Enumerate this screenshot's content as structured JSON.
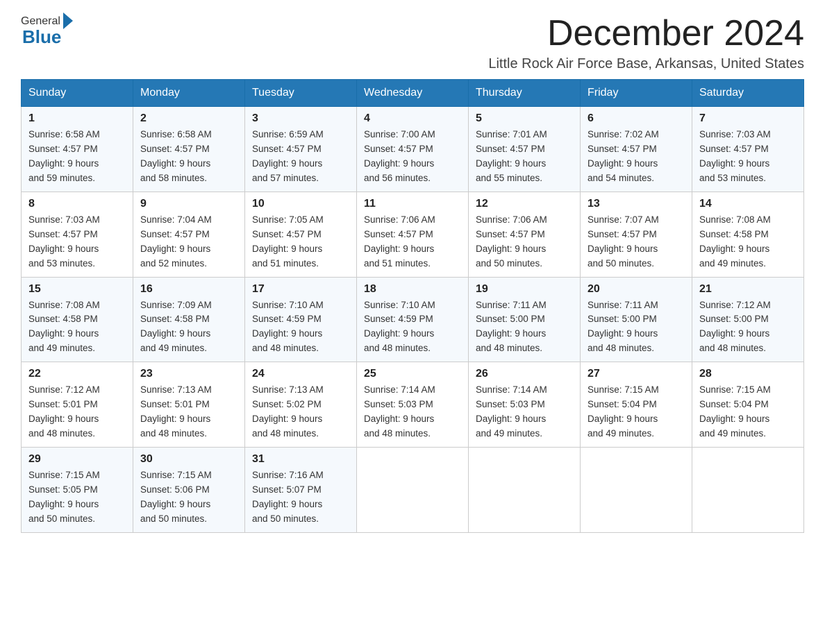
{
  "logo": {
    "general": "General",
    "blue": "Blue"
  },
  "header": {
    "month_title": "December 2024",
    "location": "Little Rock Air Force Base, Arkansas, United States"
  },
  "days_of_week": [
    "Sunday",
    "Monday",
    "Tuesday",
    "Wednesday",
    "Thursday",
    "Friday",
    "Saturday"
  ],
  "weeks": [
    [
      {
        "day": "1",
        "sunrise": "6:58 AM",
        "sunset": "4:57 PM",
        "daylight": "9 hours and 59 minutes."
      },
      {
        "day": "2",
        "sunrise": "6:58 AM",
        "sunset": "4:57 PM",
        "daylight": "9 hours and 58 minutes."
      },
      {
        "day": "3",
        "sunrise": "6:59 AM",
        "sunset": "4:57 PM",
        "daylight": "9 hours and 57 minutes."
      },
      {
        "day": "4",
        "sunrise": "7:00 AM",
        "sunset": "4:57 PM",
        "daylight": "9 hours and 56 minutes."
      },
      {
        "day": "5",
        "sunrise": "7:01 AM",
        "sunset": "4:57 PM",
        "daylight": "9 hours and 55 minutes."
      },
      {
        "day": "6",
        "sunrise": "7:02 AM",
        "sunset": "4:57 PM",
        "daylight": "9 hours and 54 minutes."
      },
      {
        "day": "7",
        "sunrise": "7:03 AM",
        "sunset": "4:57 PM",
        "daylight": "9 hours and 53 minutes."
      }
    ],
    [
      {
        "day": "8",
        "sunrise": "7:03 AM",
        "sunset": "4:57 PM",
        "daylight": "9 hours and 53 minutes."
      },
      {
        "day": "9",
        "sunrise": "7:04 AM",
        "sunset": "4:57 PM",
        "daylight": "9 hours and 52 minutes."
      },
      {
        "day": "10",
        "sunrise": "7:05 AM",
        "sunset": "4:57 PM",
        "daylight": "9 hours and 51 minutes."
      },
      {
        "day": "11",
        "sunrise": "7:06 AM",
        "sunset": "4:57 PM",
        "daylight": "9 hours and 51 minutes."
      },
      {
        "day": "12",
        "sunrise": "7:06 AM",
        "sunset": "4:57 PM",
        "daylight": "9 hours and 50 minutes."
      },
      {
        "day": "13",
        "sunrise": "7:07 AM",
        "sunset": "4:57 PM",
        "daylight": "9 hours and 50 minutes."
      },
      {
        "day": "14",
        "sunrise": "7:08 AM",
        "sunset": "4:58 PM",
        "daylight": "9 hours and 49 minutes."
      }
    ],
    [
      {
        "day": "15",
        "sunrise": "7:08 AM",
        "sunset": "4:58 PM",
        "daylight": "9 hours and 49 minutes."
      },
      {
        "day": "16",
        "sunrise": "7:09 AM",
        "sunset": "4:58 PM",
        "daylight": "9 hours and 49 minutes."
      },
      {
        "day": "17",
        "sunrise": "7:10 AM",
        "sunset": "4:59 PM",
        "daylight": "9 hours and 48 minutes."
      },
      {
        "day": "18",
        "sunrise": "7:10 AM",
        "sunset": "4:59 PM",
        "daylight": "9 hours and 48 minutes."
      },
      {
        "day": "19",
        "sunrise": "7:11 AM",
        "sunset": "5:00 PM",
        "daylight": "9 hours and 48 minutes."
      },
      {
        "day": "20",
        "sunrise": "7:11 AM",
        "sunset": "5:00 PM",
        "daylight": "9 hours and 48 minutes."
      },
      {
        "day": "21",
        "sunrise": "7:12 AM",
        "sunset": "5:00 PM",
        "daylight": "9 hours and 48 minutes."
      }
    ],
    [
      {
        "day": "22",
        "sunrise": "7:12 AM",
        "sunset": "5:01 PM",
        "daylight": "9 hours and 48 minutes."
      },
      {
        "day": "23",
        "sunrise": "7:13 AM",
        "sunset": "5:01 PM",
        "daylight": "9 hours and 48 minutes."
      },
      {
        "day": "24",
        "sunrise": "7:13 AM",
        "sunset": "5:02 PM",
        "daylight": "9 hours and 48 minutes."
      },
      {
        "day": "25",
        "sunrise": "7:14 AM",
        "sunset": "5:03 PM",
        "daylight": "9 hours and 48 minutes."
      },
      {
        "day": "26",
        "sunrise": "7:14 AM",
        "sunset": "5:03 PM",
        "daylight": "9 hours and 49 minutes."
      },
      {
        "day": "27",
        "sunrise": "7:15 AM",
        "sunset": "5:04 PM",
        "daylight": "9 hours and 49 minutes."
      },
      {
        "day": "28",
        "sunrise": "7:15 AM",
        "sunset": "5:04 PM",
        "daylight": "9 hours and 49 minutes."
      }
    ],
    [
      {
        "day": "29",
        "sunrise": "7:15 AM",
        "sunset": "5:05 PM",
        "daylight": "9 hours and 50 minutes."
      },
      {
        "day": "30",
        "sunrise": "7:15 AM",
        "sunset": "5:06 PM",
        "daylight": "9 hours and 50 minutes."
      },
      {
        "day": "31",
        "sunrise": "7:16 AM",
        "sunset": "5:07 PM",
        "daylight": "9 hours and 50 minutes."
      },
      null,
      null,
      null,
      null
    ]
  ],
  "labels": {
    "sunrise": "Sunrise: ",
    "sunset": "Sunset: ",
    "daylight": "Daylight: "
  }
}
